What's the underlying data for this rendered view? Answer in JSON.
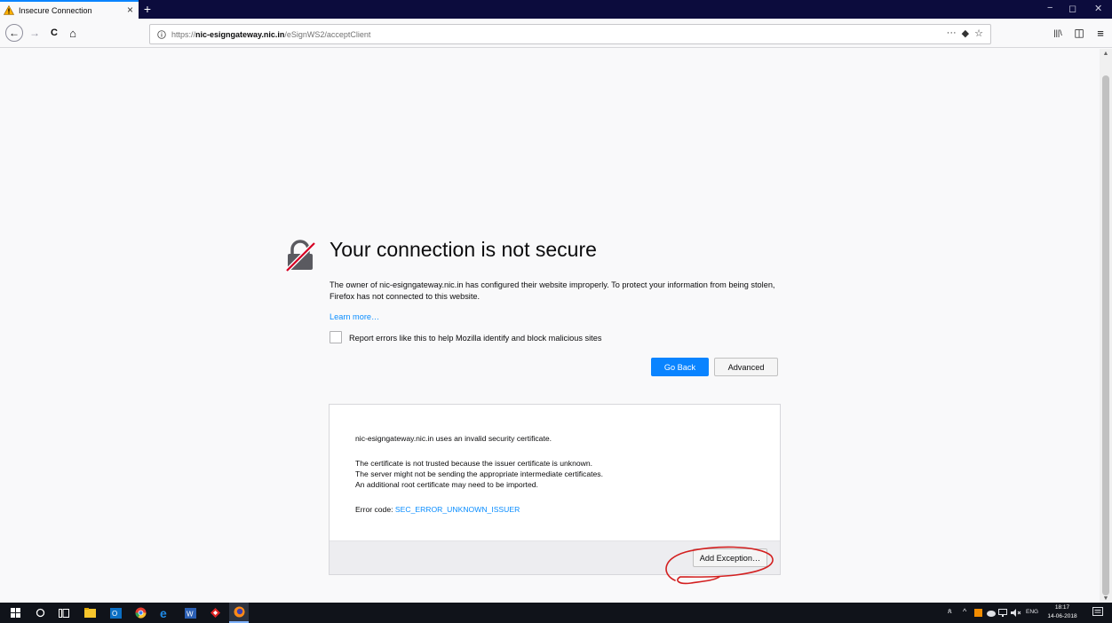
{
  "browser": {
    "tab": {
      "title": "Insecure Connection",
      "close_glyph": "×"
    },
    "new_tab_glyph": "+",
    "window_controls": {
      "minimize": "−",
      "maximize": "◻",
      "close": "✕"
    },
    "nav": {
      "back": "←",
      "forward": "→",
      "reload": "C",
      "home": "⌂"
    },
    "url": {
      "prefix": "https://",
      "host": "nic-esigngateway.nic.in",
      "path": "/eSignWS2/acceptClient"
    },
    "url_tools": {
      "more": "···",
      "pocket": "◆",
      "bookmark": "☆"
    },
    "toolbar_right": {
      "library": "|||\\",
      "sidebar": "◫",
      "menu": "≡"
    }
  },
  "error_page": {
    "title": "Your connection is not secure",
    "description": "The owner of nic-esigngateway.nic.in has configured their website improperly. To protect your information from being stolen, Firefox has not connected to this website.",
    "learn_more": "Learn more…",
    "report_label": "Report errors like this to help Mozilla identify and block malicious sites",
    "go_back_label": "Go Back",
    "advanced_label": "Advanced",
    "advanced_panel": {
      "invalid_cert": "nic-esigngateway.nic.in uses an invalid security certificate.",
      "line1": "The certificate is not trusted because the issuer certificate is unknown.",
      "line2": "The server might not be sending the appropriate intermediate certificates.",
      "line3": "An additional root certificate may need to be imported.",
      "error_code_label": "Error code: ",
      "error_code": "SEC_ERROR_UNKNOWN_ISSUER",
      "add_exception_label": "Add Exception…"
    }
  },
  "taskbar": {
    "tray": {
      "people": "ጰ",
      "chevron": "^",
      "lang": "ENG"
    },
    "clock": {
      "time": "18:17",
      "date": "14-06-2018"
    }
  },
  "colors": {
    "accent": "#0a84ff",
    "link": "#0a8dff",
    "tabstrip": "#0c0c3d",
    "annotation": "#d32020"
  }
}
